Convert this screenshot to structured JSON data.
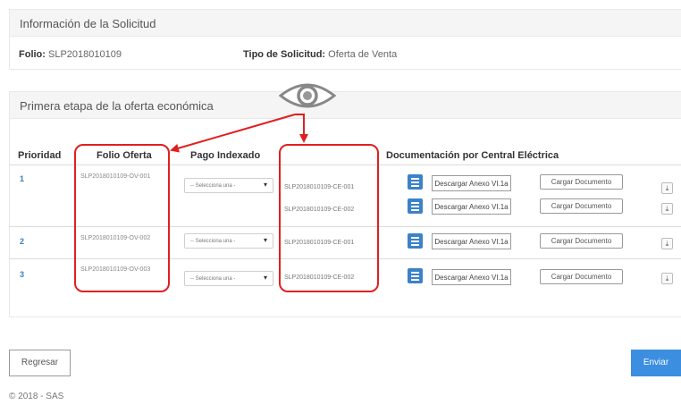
{
  "solicitud": {
    "header": "Información de la Solicitud",
    "folio_label": "Folio:",
    "folio_value": "SLP2018010109",
    "tipo_label": "Tipo de Solicitud:",
    "tipo_value": "Oferta de Venta"
  },
  "oferta": {
    "header": "Primera etapa de la oferta económica",
    "columns": {
      "prioridad": "Prioridad",
      "folio": "Folio Oferta",
      "pago": "Pago Indexado",
      "documentacion": "Documentación por Central Eléctrica"
    },
    "select_placeholder": "-- Selecciona una -",
    "descargar_label": "Descargar Anexo VI.1a",
    "cargar_label": "Cargar Documento",
    "rows": [
      {
        "prioridad": "1",
        "folio": "SLP2018010109-OV-001",
        "centrales": [
          "SLP2018010109-CE-001",
          "SLP2018010109-CE-002"
        ]
      },
      {
        "prioridad": "2",
        "folio": "SLP2018010109-OV-002",
        "centrales": [
          "SLP2018010109-CE-001"
        ]
      },
      {
        "prioridad": "3",
        "folio": "SLP2018010109-OV-003",
        "centrales": [
          "SLP2018010109-CE-002"
        ]
      }
    ]
  },
  "icons": {
    "eye": "eye-icon",
    "list": "list-icon",
    "download": "download-icon",
    "caret": "caret-down-icon"
  },
  "colors": {
    "accent": "#3c82c9",
    "annotation": "#e02020",
    "send": "#3c8ee0"
  },
  "actions": {
    "back_label": "Regresar",
    "send_label": "Enviar"
  },
  "footer": {
    "copyright": "© 2018 - SAS"
  }
}
